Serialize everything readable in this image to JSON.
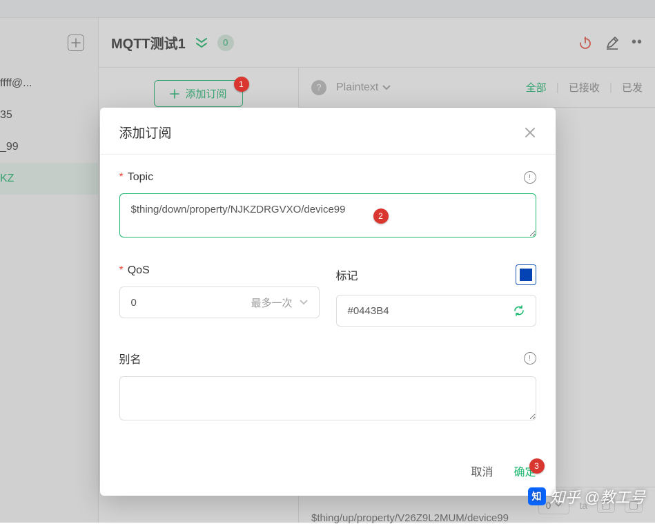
{
  "header": {
    "connection_name": "MQTT测试1",
    "badge": "0"
  },
  "sidebar": {
    "items": [
      "ffff@...",
      "35",
      "_99",
      "KZ"
    ]
  },
  "sub_panel": {
    "add_label": "添加订阅"
  },
  "msg_panel": {
    "format": "Plaintext",
    "tabs": {
      "all": "全部",
      "received": "已接收",
      "sent": "已发"
    },
    "footer_qos": "0",
    "bottom_topic": "$thing/up/property/V26Z9L2MUM/device99"
  },
  "dialog": {
    "title": "添加订阅",
    "topic_label": "Topic",
    "topic_value": "$thing/down/property/NJKZDRGVXO/device99",
    "qos_label": "QoS",
    "qos_value": "0",
    "qos_text": "最多一次",
    "mark_label": "标记",
    "color_value": "#0443B4",
    "alias_label": "别名",
    "cancel": "取消",
    "confirm": "确定"
  },
  "annotations": {
    "a1": "1",
    "a2": "2",
    "a3": "3"
  },
  "watermark": "知乎 @教工号"
}
